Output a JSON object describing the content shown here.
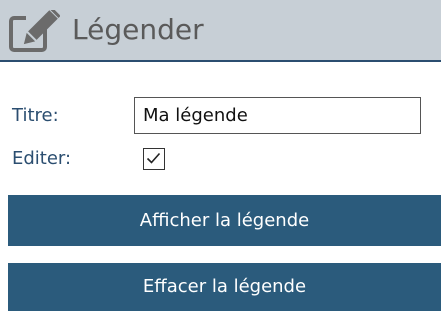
{
  "header": {
    "title": "Légender",
    "icon": "edit-pencil-icon"
  },
  "form": {
    "title_label": "Titre:",
    "title_value": "Ma légende",
    "edit_label": "Editer:",
    "edit_checked": true
  },
  "actions": {
    "show_label": "Afficher la légende",
    "clear_label": "Effacer la légende"
  },
  "colors": {
    "header_bg": "#c7cfd6",
    "accent": "#2b5b7c",
    "label_text": "#2b4e70"
  }
}
